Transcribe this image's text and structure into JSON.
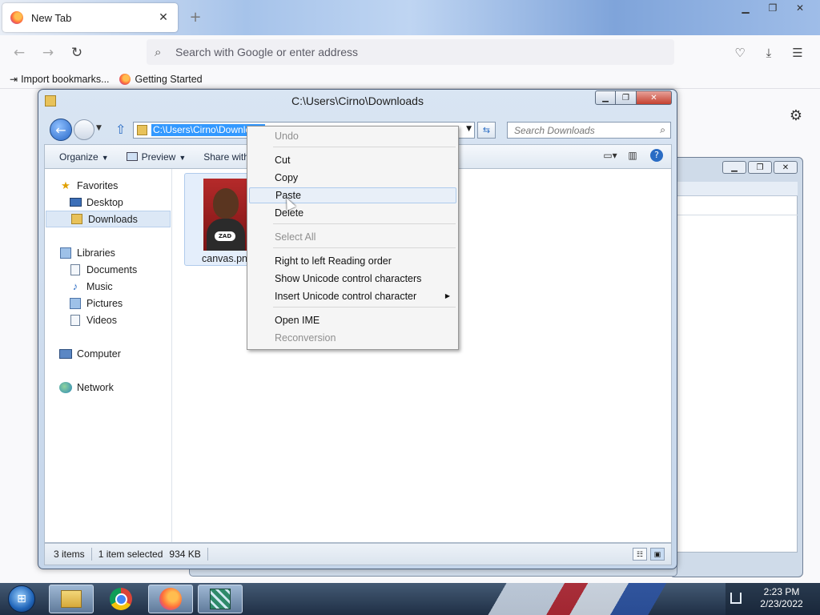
{
  "browser": {
    "tab_title": "New Tab",
    "url_placeholder": "Search with Google or enter address",
    "bookmarks": [
      "Import bookmarks...",
      "Getting Started"
    ]
  },
  "explorer": {
    "title": "C:\\Users\\Cirno\\Downloads",
    "address_selected": "C:\\Users\\Cirno\\Downloads",
    "search_placeholder": "Search Downloads",
    "commands": {
      "organize": "Organize",
      "preview": "Preview",
      "share": "Share with"
    },
    "nav": {
      "favorites": "Favorites",
      "desktop": "Desktop",
      "downloads": "Downloads",
      "libraries": "Libraries",
      "documents": "Documents",
      "music": "Music",
      "pictures": "Pictures",
      "videos": "Videos",
      "computer": "Computer",
      "network": "Network"
    },
    "files": [
      {
        "name": "canvas.png",
        "thumb_text": "ZAD"
      }
    ],
    "status": {
      "count": "3 items",
      "selected": "1 item selected",
      "size": "934 KB"
    }
  },
  "context_menu": {
    "undo": "Undo",
    "cut": "Cut",
    "copy": "Copy",
    "paste": "Paste",
    "delete": "Delete",
    "select_all": "Select All",
    "rtl": "Right to left Reading order",
    "show_unicode": "Show Unicode control characters",
    "insert_unicode": "Insert Unicode control character",
    "open_ime": "Open IME",
    "reconversion": "Reconversion",
    "hovered_item": "Paste"
  },
  "taskbar": {
    "time": "2:23 PM",
    "date": "2/23/2022"
  },
  "icons": {
    "back": "arrow-left-icon",
    "forward": "arrow-right-icon",
    "reload": "reload-icon",
    "search": "search-icon",
    "pocket": "pocket-icon",
    "download": "download-icon",
    "menu": "hamburger-menu-icon",
    "settings": "gear-icon"
  }
}
